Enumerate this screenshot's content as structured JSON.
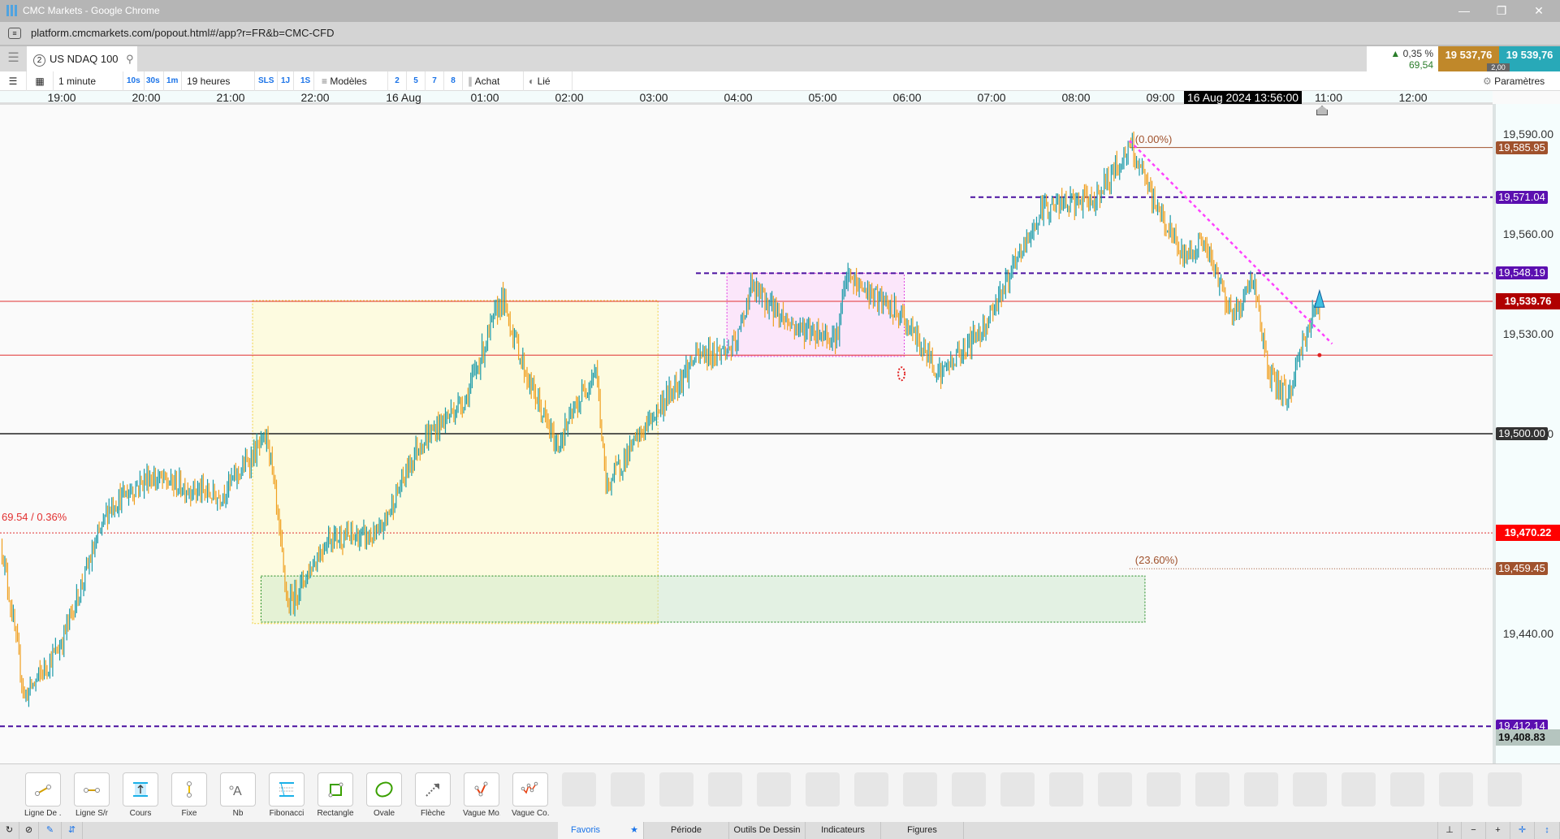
{
  "window": {
    "title": "CMC Markets - Google Chrome",
    "url": "platform.cmcmarkets.com/popout.html#/app?r=FR&b=CMC-CFD"
  },
  "instrument": {
    "tab_number": "2",
    "name": "US NDAQ 100",
    "change_pct": "0,35 %",
    "change_abs": "69,54",
    "sell": "19 537,76",
    "buy": "19 539,76",
    "spread": "2,00"
  },
  "toolbar": {
    "interval": "1 minute",
    "quick_intervals": [
      "10s",
      "30s",
      "1m"
    ],
    "range": "19 heures",
    "quick_ranges": [
      "SLS",
      "1J",
      "1S"
    ],
    "templates": "Modèles",
    "layouts": [
      "2",
      "5",
      "7",
      "8"
    ],
    "chart_type": "Achat",
    "link": "Lié",
    "settings": "Paramètres"
  },
  "time_axis": {
    "labels": [
      "19:00",
      "20:00",
      "21:00",
      "22:00",
      "16 Aug",
      "01:00",
      "02:00",
      "03:00",
      "04:00",
      "05:00",
      "06:00",
      "07:00",
      "08:00",
      "09:00",
      "11:00",
      "12:00"
    ],
    "crosshair": "16 Aug 2024 13:56:00"
  },
  "chart_data": {
    "type": "candlestick",
    "timeframe": "1 minute",
    "price_ticks": [
      "19,590.00",
      "19,560.00",
      "19,530.00",
      "19,500.00",
      "19,440.00"
    ],
    "ylim": [
      19400,
      19596
    ],
    "close_path": [
      [
        0,
        19466
      ],
      [
        2,
        19460
      ],
      [
        16,
        19421
      ],
      [
        41,
        19436
      ],
      [
        76,
        19478
      ],
      [
        104,
        19487
      ],
      [
        154,
        19481
      ],
      [
        189,
        19499
      ],
      [
        203,
        19448
      ],
      [
        232,
        19469
      ],
      [
        267,
        19469
      ],
      [
        295,
        19496
      ],
      [
        330,
        19511
      ],
      [
        355,
        19541
      ],
      [
        373,
        19517
      ],
      [
        394,
        19496
      ],
      [
        422,
        19520
      ],
      [
        429,
        19484
      ],
      [
        457,
        19502
      ],
      [
        493,
        19523
      ],
      [
        521,
        19526
      ],
      [
        532,
        19544
      ],
      [
        563,
        19532
      ],
      [
        593,
        19529
      ],
      [
        600,
        19547
      ],
      [
        639,
        19535
      ],
      [
        667,
        19518
      ],
      [
        697,
        19532
      ],
      [
        719,
        19550
      ],
      [
        740,
        19568
      ],
      [
        775,
        19570
      ],
      [
        802,
        19586
      ],
      [
        818,
        19570
      ],
      [
        839,
        19553
      ],
      [
        853,
        19558
      ],
      [
        875,
        19535
      ],
      [
        889,
        19547
      ],
      [
        900,
        19517
      ],
      [
        914,
        19511
      ],
      [
        925,
        19529
      ],
      [
        936,
        19540
      ]
    ],
    "markers": [
      {
        "label": "19,585.95",
        "color": "#a0522d",
        "price": 19585.95
      },
      {
        "label": "19,571.04",
        "color": "#5b0fb0",
        "price": 19571.04
      },
      {
        "label": "19,548.19",
        "color": "#5b0fb0",
        "price": 19548.19
      },
      {
        "label": "19,539.76",
        "color": "#b00000",
        "price": 19539.76
      },
      {
        "label": "19,500.00",
        "color": "#333333",
        "price": 19500
      },
      {
        "label": "19,470.22",
        "color": "#ff0000",
        "price": 19470.22
      },
      {
        "label": "19,459.45",
        "color": "#a0522d",
        "price": 19459.45
      },
      {
        "label": "19,412.14",
        "color": "#5b0fb0",
        "price": 19412.14
      },
      {
        "label": "19,408.83",
        "color": "#b5c5bf",
        "price": 19408.83
      }
    ],
    "change_label": "69.54 / 0.36%",
    "fib_labels": [
      "(0.00%)",
      "(23.60%)"
    ],
    "colors": {
      "up": "#1a9aa8",
      "down": "#f0a020"
    }
  },
  "drawing_tools": [
    "Ligne De ...",
    "Ligne S/r",
    "Cours",
    "Fixe",
    "Nb",
    "Fibonacci",
    "Rectangle",
    "Ovale",
    "Flèche",
    "Vague Mo...",
    "Vague Co..."
  ],
  "bottom_tabs": [
    "Favoris",
    "Période",
    "Outils De Dessin",
    "Indicateurs",
    "Figures"
  ]
}
